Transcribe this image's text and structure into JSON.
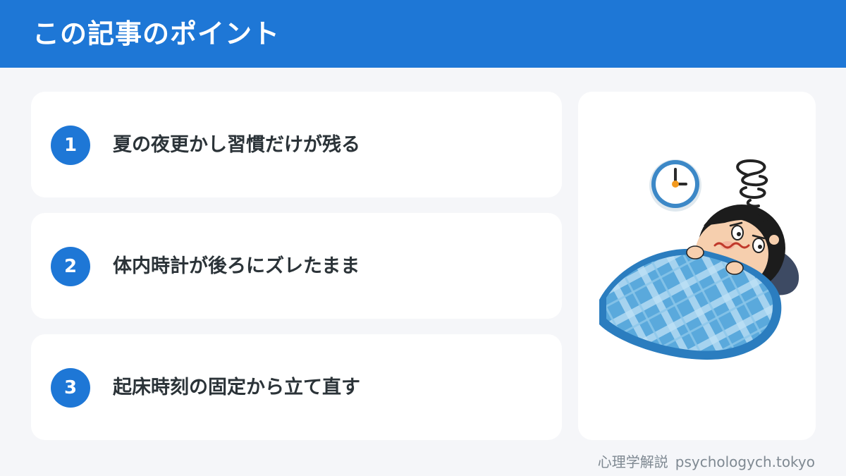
{
  "header": {
    "title": "この記事のポイント",
    "background_color": "#1e77d6"
  },
  "points": [
    {
      "number": "1",
      "text": "夏の夜更かし習慣だけが残る"
    },
    {
      "number": "2",
      "text": "体内時計が後ろにズレたまま"
    },
    {
      "number": "3",
      "text": "起床時刻の固定から立て直す"
    }
  ],
  "illustration": {
    "subject": "person-lying-awake-in-bed-with-clock",
    "clock_icon": "clock-icon",
    "dizzy_icon": "dizzy-spiral-icon"
  },
  "footer": {
    "brand": "心理学解説",
    "site": "psychologych.tokyo"
  },
  "colors": {
    "accent": "#1e77d6",
    "page_background": "#f5f6f9",
    "card": "#ffffff",
    "text": "#2b3338"
  }
}
